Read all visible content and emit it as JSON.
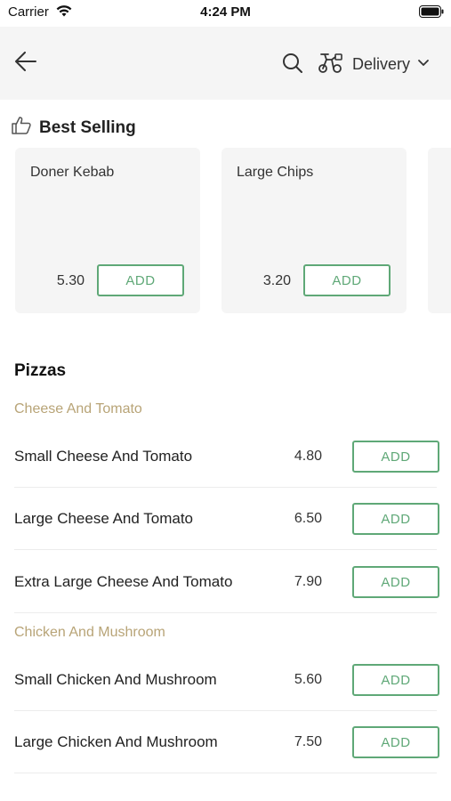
{
  "status_bar": {
    "carrier": "Carrier",
    "time": "4:24 PM"
  },
  "nav": {
    "back_icon": "arrow-left-icon",
    "search_icon": "search-icon",
    "delivery_icon": "scooter-icon",
    "delivery_label": "Delivery",
    "chevron_icon": "chevron-down-icon"
  },
  "best_selling": {
    "title": "Best Selling",
    "icon": "thumbs-up-icon",
    "items": [
      {
        "name": "Doner Kebab",
        "price": "5.30",
        "add_label": "ADD"
      },
      {
        "name": "Large Chips",
        "price": "3.20",
        "add_label": "ADD"
      }
    ]
  },
  "menu": {
    "section_title": "Pizzas",
    "categories": [
      {
        "name": "Cheese And Tomato",
        "items": [
          {
            "name": "Small Cheese And Tomato",
            "price": "4.80",
            "add_label": "ADD"
          },
          {
            "name": "Large Cheese And Tomato",
            "price": "6.50",
            "add_label": "ADD"
          },
          {
            "name": "Extra Large Cheese And Tomato",
            "price": "7.90",
            "add_label": "ADD"
          }
        ]
      },
      {
        "name": "Chicken And Mushroom",
        "items": [
          {
            "name": "Small Chicken And Mushroom",
            "price": "5.60",
            "add_label": "ADD"
          },
          {
            "name": "Large Chicken And Mushroom",
            "price": "7.50",
            "add_label": "ADD"
          }
        ]
      }
    ]
  },
  "colors": {
    "accent": "#5fa877",
    "category": "#b8a477",
    "nav_bg": "#f5f5f5"
  }
}
